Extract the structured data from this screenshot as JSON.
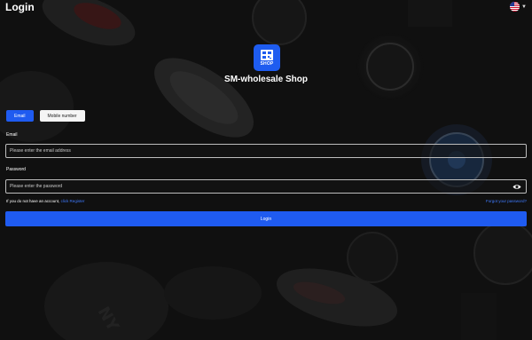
{
  "header": {
    "title": "Login",
    "language_flag": "us-flag-icon"
  },
  "brand": {
    "logo_text": "SHOP",
    "name": "SM-wholesale Shop",
    "color": "#1e5cf0"
  },
  "tabs": [
    {
      "label": "Email",
      "active": true
    },
    {
      "label": "Mobile number",
      "active": false
    }
  ],
  "form": {
    "email_label": "Email",
    "email_placeholder": "Please enter the email address",
    "password_label": "Password",
    "password_placeholder": "Please enter the password",
    "no_account_text": "If you do not have an account,",
    "register_link": "click Register",
    "forgot_link": "Forgot your password?",
    "login_button": "Login"
  },
  "colors": {
    "accent": "#1f5bf0",
    "link": "#3f7bff",
    "background": "#141414"
  }
}
